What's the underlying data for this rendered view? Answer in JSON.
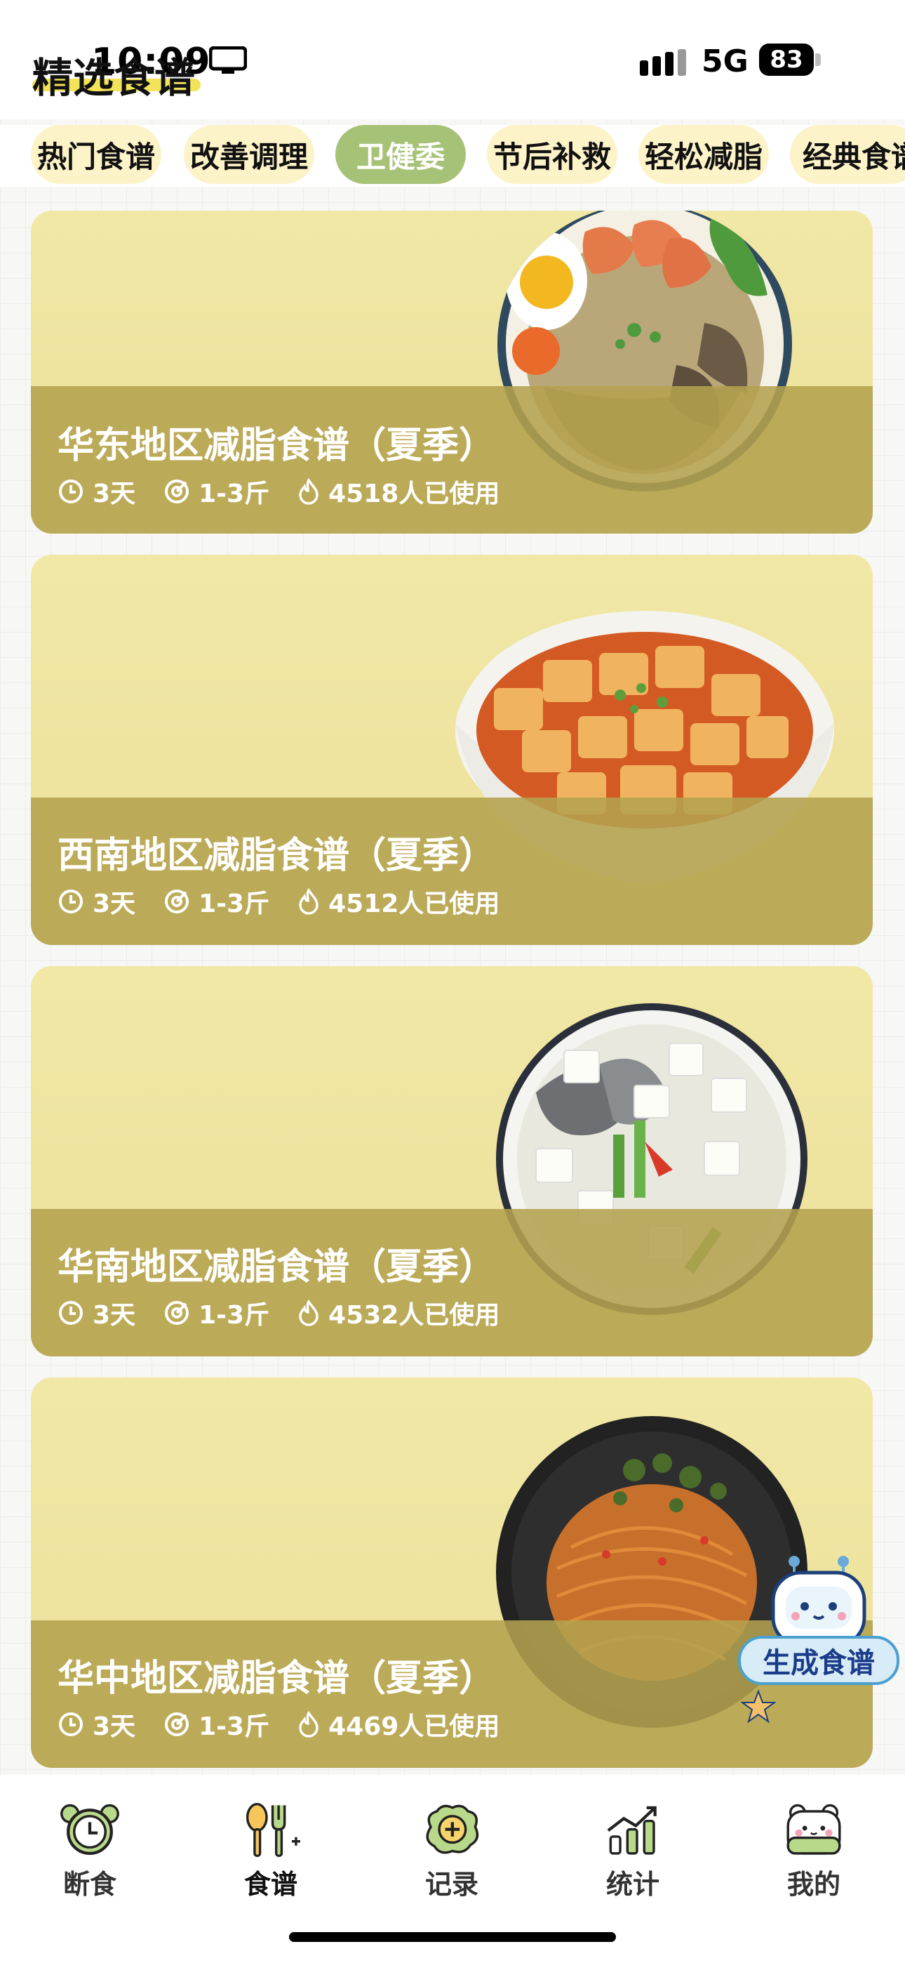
{
  "status_bar": {
    "time": "10:09",
    "network": "5G",
    "battery": "83"
  },
  "page_title": "精选食谱",
  "tabs": [
    {
      "label": "热门食谱",
      "active": false
    },
    {
      "label": "改善调理",
      "active": false
    },
    {
      "label": "卫健委",
      "active": true
    },
    {
      "label": "节后补救",
      "active": false
    },
    {
      "label": "轻松减脂",
      "active": false
    },
    {
      "label": "经典食谱",
      "active": false
    }
  ],
  "cards": [
    {
      "title": "华东地区减脂食谱（夏季）",
      "days": "3天",
      "weight": "1-3斤",
      "users": "4518人已使用",
      "dish": "shrimp-noodle-bowl"
    },
    {
      "title": "西南地区减脂食谱（夏季）",
      "days": "3天",
      "weight": "1-3斤",
      "users": "4512人已使用",
      "dish": "mapo-tofu-bowl"
    },
    {
      "title": "华南地区减脂食谱（夏季）",
      "days": "3天",
      "weight": "1-3斤",
      "users": "4532人已使用",
      "dish": "fish-tofu-soup"
    },
    {
      "title": "华中地区减脂食谱（夏季）",
      "days": "3天",
      "weight": "1-3斤",
      "users": "4469人已使用",
      "dish": "spicy-noodles"
    }
  ],
  "generate_button": "生成食谱",
  "nav": [
    {
      "label": "断食",
      "icon": "alarm-clock-icon"
    },
    {
      "label": "食谱",
      "icon": "spoon-fork-icon"
    },
    {
      "label": "记录",
      "icon": "plus-cloud-icon"
    },
    {
      "label": "统计",
      "icon": "chart-icon"
    },
    {
      "label": "我的",
      "icon": "bear-face-icon"
    }
  ],
  "colors": {
    "tab_bg": "#fdf3c8",
    "tab_active": "#a6c277",
    "card_bg": "#f1e8a6",
    "card_band": "#b4a24e"
  }
}
